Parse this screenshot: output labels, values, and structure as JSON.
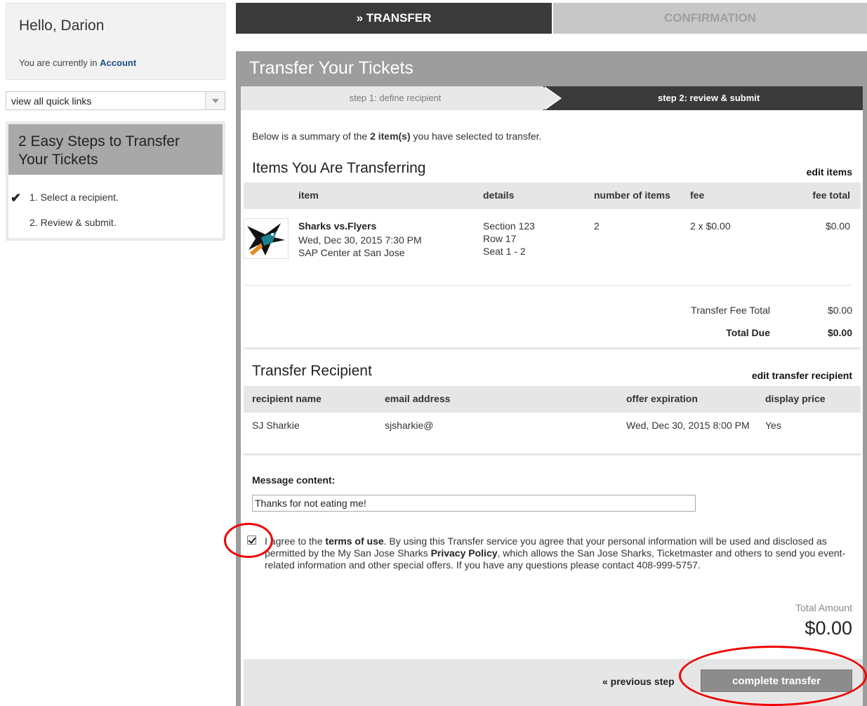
{
  "sidebar": {
    "greeting": "Hello, Darion",
    "location_prefix": "You are currently in",
    "location_name": "Account",
    "quick_links": "view all quick links",
    "steps_title": "2 Easy Steps to Transfer Your Tickets",
    "steps": [
      "1. Select a recipient.",
      "2. Review & submit."
    ],
    "check_mark": "✔"
  },
  "tabs": {
    "transfer": "» TRANSFER",
    "confirmation": "CONFIRMATION"
  },
  "main": {
    "title": "Transfer Your Tickets",
    "wizard": {
      "step1": "step 1: define recipient",
      "step2": "step 2: review & submit"
    },
    "summary_prefix": "Below is a summary of the",
    "summary_count": "2 item(s)",
    "summary_suffix": "you have selected to transfer.",
    "items_heading": "Items You Are Transferring",
    "edit_items": "edit items",
    "items_columns": [
      "item",
      "details",
      "number of items",
      "fee",
      "fee total"
    ],
    "item": {
      "name": "Sharks vs.Flyers",
      "date": "Wed, Dec 30, 2015 7:30 PM",
      "venue": "SAP Center at San Jose",
      "section": "Section 123",
      "row": "Row 17",
      "seat": "Seat 1 - 2",
      "number": "2",
      "fee": "2 x $0.00",
      "fee_total": "$0.00"
    },
    "transfer_fee_total_label": "Transfer Fee Total",
    "transfer_fee_total": "$0.00",
    "total_due_label": "Total Due",
    "total_due": "$0.00",
    "recipient_heading": "Transfer Recipient",
    "edit_recipient": "edit transfer recipient",
    "recipient_columns": [
      "recipient name",
      "email address",
      "offer expiration",
      "display price"
    ],
    "recipient": {
      "name": "SJ Sharkie",
      "email": "sjsharkie@",
      "expiration": "Wed, Dec 30, 2015 8:00 PM",
      "display_price": "Yes"
    },
    "message_label": "Message content:",
    "message_value": "Thanks for not eating me!",
    "agree": {
      "p1": "I agree to the ",
      "terms": "terms of use",
      "p2": ". By using this Transfer service you agree that your personal information will be used and disclosed as permitted by the My San Jose Sharks ",
      "privacy": "Privacy Policy",
      "p3": ", which allows the San Jose Sharks, Ticketmaster and others to send you event-related information and other special offers. If you have any questions please contact 408-999-5757.",
      "checked": true
    },
    "total_amount_label": "Total Amount",
    "total_amount": "$0.00",
    "previous_step": "« previous step",
    "complete_transfer": "complete transfer"
  },
  "colors": {
    "dark_tab": "#3a3a3a",
    "panel_gray": "#9d9d9d",
    "link_blue": "#1d4f86",
    "annotation_red": "#ee0000"
  }
}
